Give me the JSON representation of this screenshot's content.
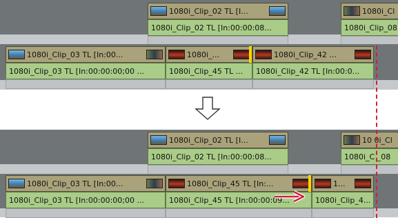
{
  "before": {
    "upper_video": [
      {
        "label": "1080i_Clip_02  TL [I...",
        "thumb": "blue"
      },
      {
        "label": "1080i_Cl",
        "thumb": "mixed"
      }
    ],
    "upper_audio": [
      {
        "label": "1080i_Clip_02  TL [In:00:00:08..."
      },
      {
        "label": "1080i_Clip_08"
      }
    ],
    "lower_video": [
      {
        "label": "1080i_Clip_03  TL [In:00...",
        "thumb": "blue"
      },
      {
        "label": "1080i_...",
        "thumb": "red"
      },
      {
        "label": "1080i_Clip_42  ...",
        "thumb": "red"
      }
    ],
    "lower_audio": [
      {
        "label": "1080i_Clip_03  TL [In:00:00:00;00 ..."
      },
      {
        "label": "1080i_Clip_45  TL ..."
      },
      {
        "label": "1080i_Clip_42  TL [In:00:0..."
      }
    ]
  },
  "after": {
    "upper_video": [
      {
        "label": "1080i_Clip_02  TL [I...",
        "thumb": "blue"
      },
      {
        "label": "10 0i_Cl",
        "thumb": "mixed"
      }
    ],
    "upper_audio": [
      {
        "label": "1080i_Clip_02  TL [In:00:00:08..."
      },
      {
        "label": "1080i_C  _08"
      }
    ],
    "lower_video": [
      {
        "label": "1080i_Clip_03  TL [In:00...",
        "thumb": "blue"
      },
      {
        "label": "1080i_Clip_45  TL [In:...",
        "thumb": "red"
      },
      {
        "label": "1...",
        "thumb": "red"
      }
    ],
    "lower_audio": [
      {
        "label": "1080i_Clip_03  TL [In:00:00:00;00 ..."
      },
      {
        "label": "1080i_Clip_45  TL [In:00:00:09..."
      },
      {
        "label": "1080i_Clip_4..."
      }
    ]
  },
  "icons": {
    "down_arrow": "arrow-down-icon",
    "right_arrow": "arrow-right-icon"
  },
  "colors": {
    "track_background": "#6f7476",
    "video_clip": "#a9a27a",
    "audio_clip": "#a9cc88",
    "edit_point_marker": "#ffd400",
    "guide_line": "#d0203a",
    "ripple_arrow": "#d0203a"
  }
}
